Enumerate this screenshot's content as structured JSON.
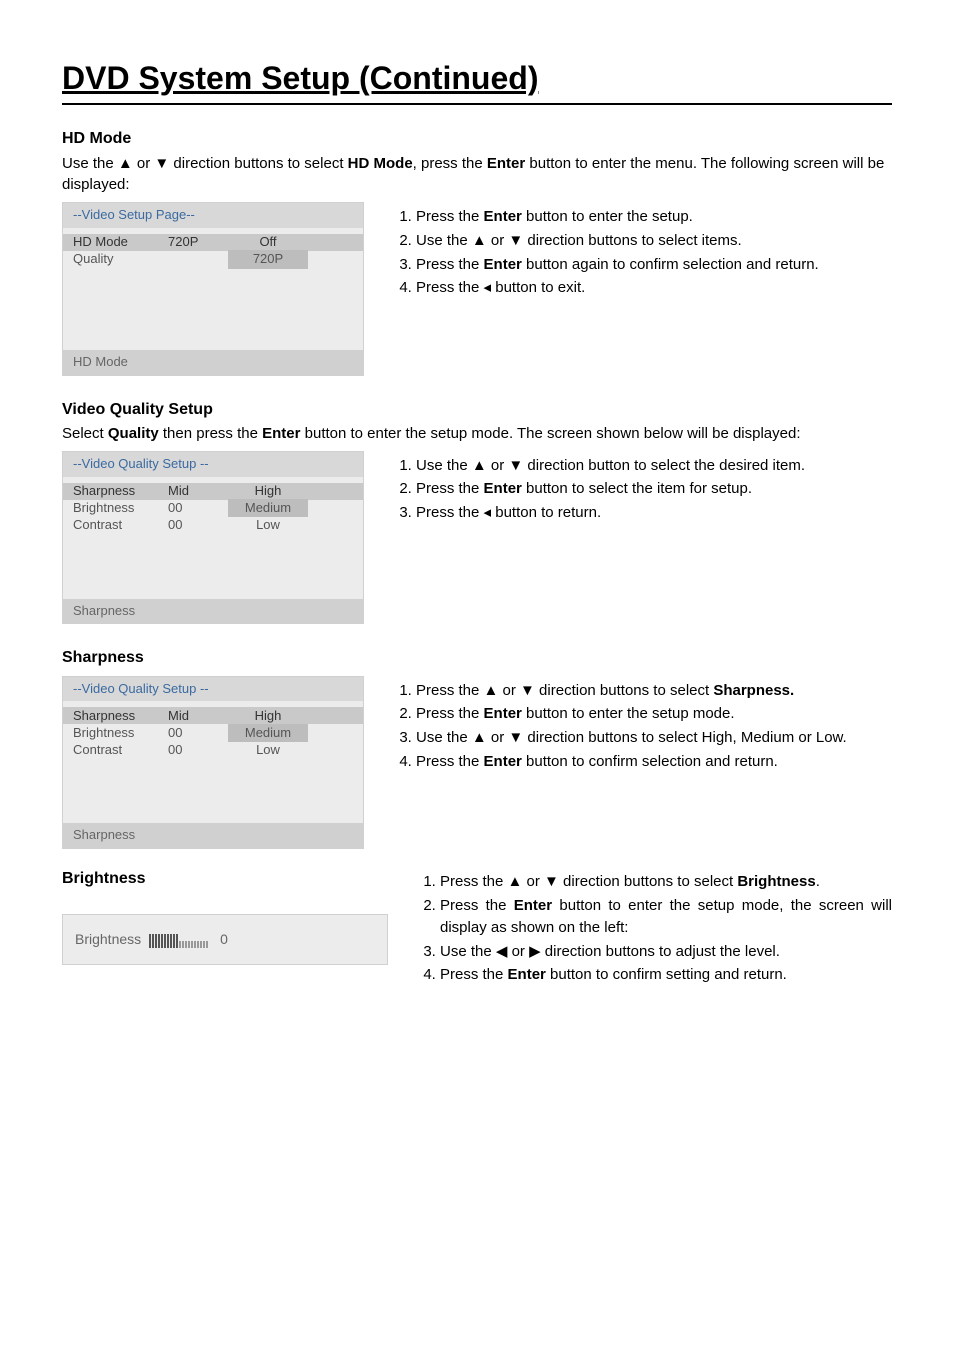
{
  "title": "DVD System Setup (Continued)",
  "hd_mode": {
    "heading": "HD Mode",
    "intro_pre": "Use the ▲ or ▼   direction buttons to select ",
    "intro_bold1": "HD Mode",
    "intro_mid": ", press the ",
    "intro_bold2": "Enter",
    "intro_post": " button to enter the menu. The following screen will be displayed:",
    "menu": {
      "header": "--Video Setup Page--",
      "rows": [
        {
          "c1": "HD Mode",
          "c2": "720P",
          "c3": "Off",
          "sel": true,
          "c3sel": false
        },
        {
          "c1": "Quality",
          "c2": "",
          "c3": "720P",
          "sel": false,
          "c3sel": true
        }
      ],
      "footer": "HD Mode"
    },
    "steps": [
      {
        "pre": "Press the ",
        "bold": "Enter",
        "post": " button to enter the setup."
      },
      {
        "pre": "Use the ▲ or ▼ direction buttons to select items.",
        "bold": "",
        "post": ""
      },
      {
        "pre": "Press the ",
        "bold": "Enter",
        "post": " button again to confirm selection and return."
      },
      {
        "pre": "Press the ◂ button to exit.",
        "bold": "",
        "post": ""
      }
    ]
  },
  "vq": {
    "heading": "Video Quality Setup",
    "intro_pre": "Select ",
    "intro_bold1": "Quality",
    "intro_mid": " then press the ",
    "intro_bold2": "Enter",
    "intro_post": " button to enter the setup mode. The screen shown below will be displayed:",
    "menu": {
      "header": "--Video  Quality Setup  --",
      "rows": [
        {
          "c1": "Sharpness",
          "c2": "Mid",
          "c3": "High",
          "sel": true,
          "c3sel": false
        },
        {
          "c1": "Brightness",
          "c2": "00",
          "c3": "Medium",
          "sel": false,
          "c3sel": true
        },
        {
          "c1": "Contrast",
          "c2": "00",
          "c3": "Low",
          "sel": false,
          "c3sel": false
        }
      ],
      "footer": "Sharpness"
    },
    "steps": [
      {
        "pre": "Use the ▲ or ▼ direction button to select the desired item.",
        "bold": "",
        "post": ""
      },
      {
        "pre": "Press the ",
        "bold": "Enter",
        "post": " button to select the item for setup."
      },
      {
        "pre": "Press the ◂ button to return.",
        "bold": "",
        "post": ""
      }
    ]
  },
  "sharp": {
    "heading": "Sharpness",
    "menu": {
      "header": "--Video  Quality Setup  --",
      "rows": [
        {
          "c1": "Sharpness",
          "c2": "Mid",
          "c3": "High",
          "sel": true,
          "c3sel": false
        },
        {
          "c1": "Brightness",
          "c2": "00",
          "c3": "Medium",
          "sel": false,
          "c3sel": true
        },
        {
          "c1": "Contrast",
          "c2": "00",
          "c3": "Low",
          "sel": false,
          "c3sel": false
        }
      ],
      "footer": "Sharpness"
    },
    "steps": [
      {
        "pre": "Press the ▲ or ▼   direction buttons to select ",
        "bold": "Sharpness.",
        "post": ""
      },
      {
        "pre": "Press the ",
        "bold": "Enter",
        "post": " button to enter the setup mode."
      },
      {
        "pre": "Use the ▲ or ▼ direction buttons to select High, Medium or Low.",
        "bold": "",
        "post": ""
      },
      {
        "pre": "Press the ",
        "bold": "Enter",
        "post": " button to confirm selection and return."
      }
    ]
  },
  "bright": {
    "heading": "Brightness",
    "bar_label": "Brightness",
    "bar_value": "0",
    "steps": [
      {
        "pre": "Press the ▲ or ▼ direction buttons to select ",
        "bold": "Brightness",
        "post": "."
      },
      {
        "pre": "Press the ",
        "bold": "Enter",
        "post": " button to enter the setup mode, the screen will display as shown on the left:"
      },
      {
        "pre": "Use the ◀ or ▶ direction buttons to adjust the level.",
        "bold": "",
        "post": ""
      },
      {
        "pre": "Press the ",
        "bold": "Enter",
        "post": " button to confirm setting and return."
      }
    ]
  }
}
